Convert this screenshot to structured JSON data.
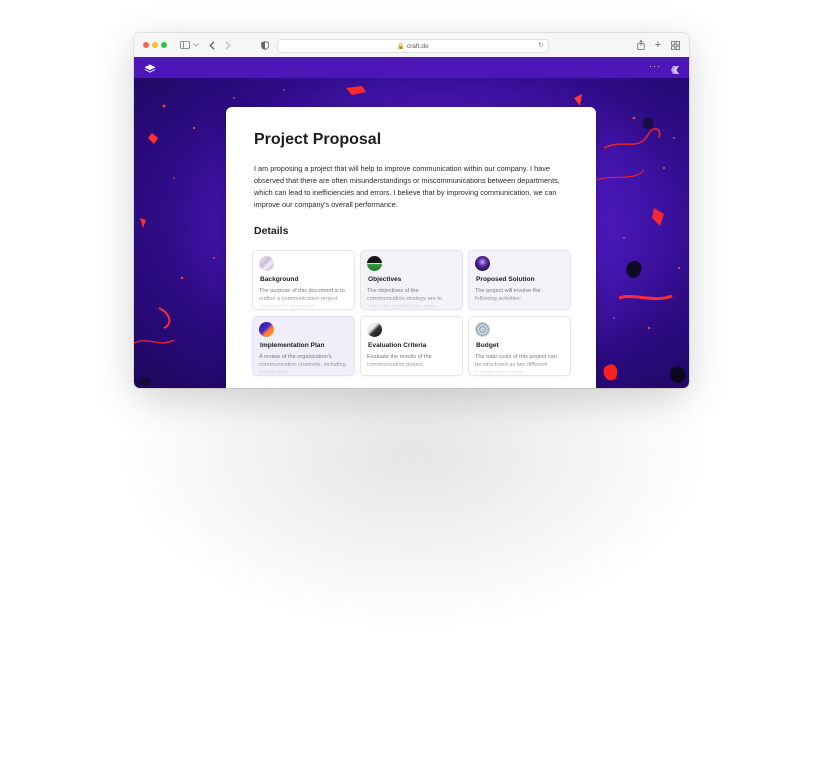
{
  "browser": {
    "url": "craft.do",
    "colors": {
      "close": "#ff5f57",
      "minimize": "#febc2e",
      "zoom": "#28c840",
      "appbar": "#4d17b8"
    }
  },
  "document": {
    "title": "Project Proposal",
    "intro": "I am proposing a project that will help to improve communication within our company. I have observed that there are often misunderstandings or miscommunications between departments, which can lead to inefficiencies and errors. I believe that by improving communication, we can improve our company's overall performance.",
    "details_heading": "Details",
    "cards": [
      {
        "title": "Background",
        "desc": "The purpose of this document is to outline a communication project proposal for improving"
      },
      {
        "title": "Objectives",
        "desc": "The objectives of the communication strategy are to make the organization more"
      },
      {
        "title": "Proposed Solution",
        "desc": "The project will involve the following activities:"
      },
      {
        "title": "Implementation Plan",
        "desc": "A review of the organization's communication channels, including face-to-face"
      },
      {
        "title": "Evaluation Criteria",
        "desc": "Evaluate the results of the communication project."
      },
      {
        "title": "Budget",
        "desc": "The total costs of this project can be structured as two different budgets depending"
      }
    ]
  }
}
